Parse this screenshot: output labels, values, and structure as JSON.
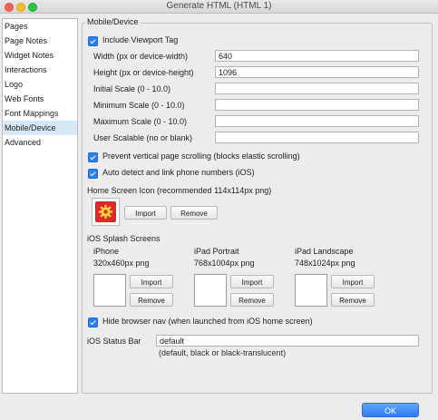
{
  "window": {
    "title": "Generate HTML (HTML 1)"
  },
  "sidebar": {
    "items": [
      {
        "label": "Pages",
        "selected": false
      },
      {
        "label": "Page Notes",
        "selected": false
      },
      {
        "label": "Widget Notes",
        "selected": false
      },
      {
        "label": "Interactions",
        "selected": false
      },
      {
        "label": "Logo",
        "selected": false
      },
      {
        "label": "Web Fonts",
        "selected": false
      },
      {
        "label": "Font Mappings",
        "selected": false
      },
      {
        "label": "Mobile/Device",
        "selected": true
      },
      {
        "label": "Advanced",
        "selected": false
      }
    ]
  },
  "panel": {
    "title": "Mobile/Device",
    "viewport": {
      "label": "Include Viewport Tag",
      "checked": true
    },
    "fields": {
      "width": {
        "label": "Width (px or device-width)",
        "value": "640"
      },
      "height": {
        "label": "Height (px or device-height)",
        "value": "1096"
      },
      "initial_scale": {
        "label": "Initial Scale (0 - 10.0)",
        "value": ""
      },
      "min_scale": {
        "label": "Minimum Scale (0 - 10.0)",
        "value": ""
      },
      "max_scale": {
        "label": "Maximum Scale (0 - 10.0)",
        "value": ""
      },
      "user_scalable": {
        "label": "User Scalable (no or blank)",
        "value": ""
      }
    },
    "prevent_scroll": {
      "label": "Prevent vertical page scrolling (blocks elastic scrolling)",
      "checked": true
    },
    "auto_phone": {
      "label": "Auto detect and link phone numbers (iOS)",
      "checked": true
    },
    "home_icon": {
      "label": "Home Screen Icon (recommended 114x114px png)",
      "import": "Import",
      "remove": "Remove",
      "icon": "gear-icon",
      "icon_color": "#e0252b"
    },
    "splash": {
      "label": "iOS Splash Screens",
      "items": [
        {
          "name": "iPhone",
          "size": "320x460px png",
          "import": "Import",
          "remove": "Remove"
        },
        {
          "name": "iPad Portrait",
          "size": "768x1004px png",
          "import": "Import",
          "remove": "Remove"
        },
        {
          "name": "iPad Landscape",
          "size": "748x1024px png",
          "import": "Import",
          "remove": "Remove"
        }
      ]
    },
    "hide_nav": {
      "label": "Hide browser nav (when launched from iOS home screen)",
      "checked": true
    },
    "status_bar": {
      "label": "iOS Status Bar",
      "value": "default",
      "hint": "(default, black or black-translucent)"
    }
  },
  "footer": {
    "ok": "OK"
  },
  "colors": {
    "accent": "#2b7ff5",
    "selected_row": "#d8e7f5",
    "icon_red": "#e0252b"
  }
}
